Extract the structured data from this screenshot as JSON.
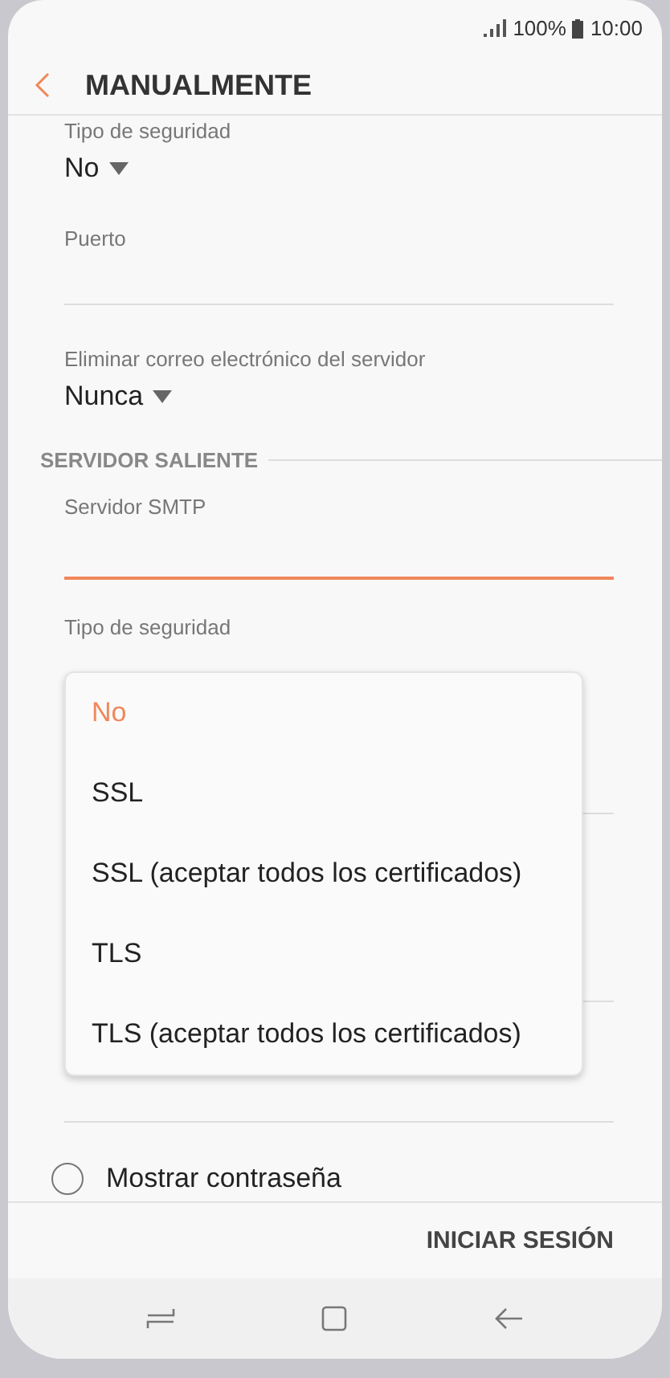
{
  "status_bar": {
    "battery": "100%",
    "time": "10:00"
  },
  "header": {
    "title": "MANUALMENTE"
  },
  "incoming": {
    "security_label": "Tipo de seguridad",
    "security_value": "No",
    "port_label": "Puerto",
    "delete_label": "Eliminar correo electrónico del servidor",
    "delete_value": "Nunca"
  },
  "outgoing": {
    "section_title": "SERVIDOR SALIENTE",
    "smtp_label": "Servidor SMTP",
    "smtp_focused": true,
    "security_label": "Tipo de seguridad"
  },
  "security_menu": {
    "options": [
      {
        "label": "No",
        "selected": true
      },
      {
        "label": "SSL",
        "selected": false
      },
      {
        "label": "SSL (aceptar todos los certificados)",
        "selected": false
      },
      {
        "label": "TLS",
        "selected": false
      },
      {
        "label": "TLS (aceptar todos los certificados)",
        "selected": false
      }
    ]
  },
  "show_password": {
    "label": "Mostrar contraseña",
    "checked": false
  },
  "action": {
    "label": "INICIAR SESIÓN"
  }
}
